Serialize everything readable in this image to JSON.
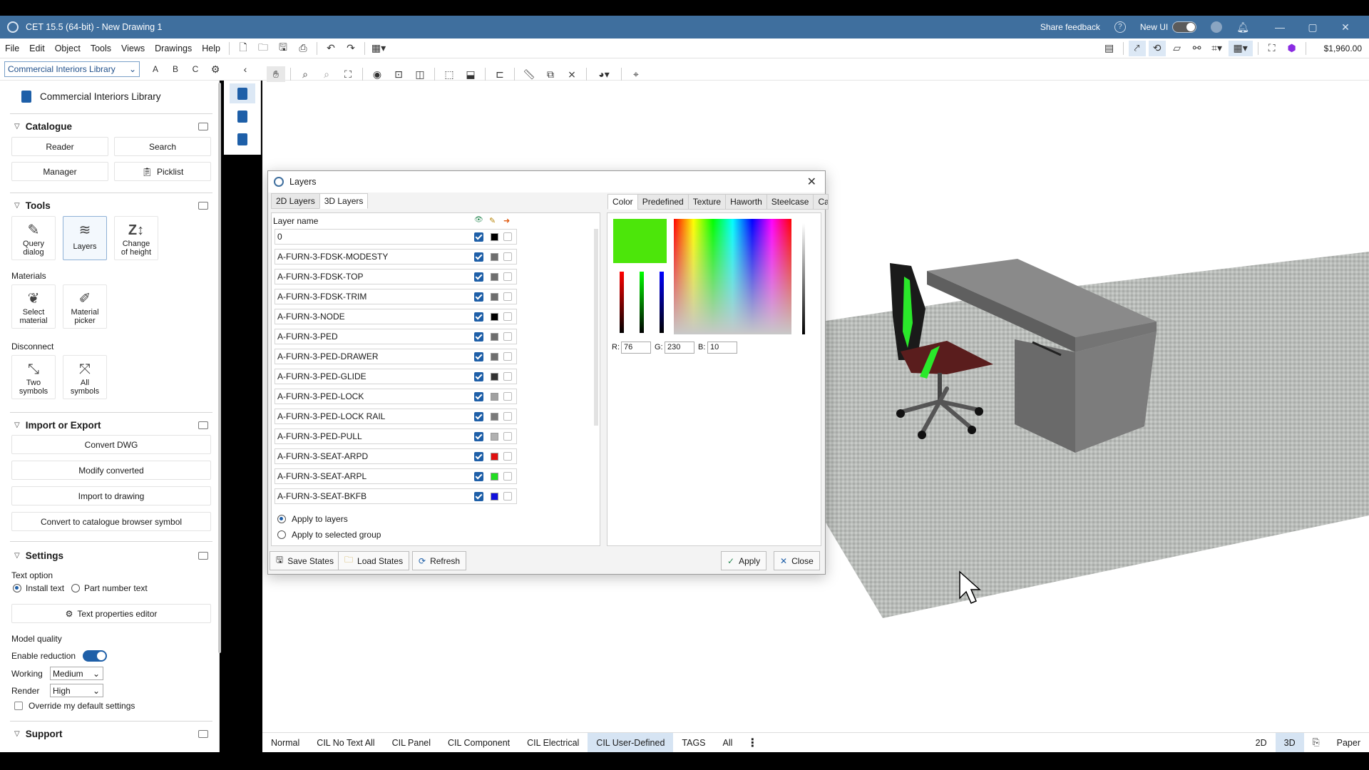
{
  "window": {
    "title": "CET 15.5 (64-bit) - New Drawing 1",
    "share_feedback": "Share feedback",
    "new_ui_label": "New UI",
    "minimize": "—",
    "maximize": "▢",
    "close": "✕"
  },
  "menu": {
    "items": [
      "File",
      "Edit",
      "Object",
      "Tools",
      "Views",
      "Drawings",
      "Help"
    ],
    "price": "$1,960.00"
  },
  "toolbar": {
    "library_select": "Commercial Interiors Library",
    "letters": [
      "A",
      "B",
      "C"
    ]
  },
  "left_panel": {
    "library_title": "Commercial Interiors Library",
    "catalogue": {
      "title": "Catalogue",
      "buttons": [
        "Reader",
        "Search",
        "Manager",
        "Picklist"
      ]
    },
    "tools": {
      "title": "Tools",
      "items": [
        {
          "line1": "Query",
          "line2": "dialog"
        },
        {
          "line1": "Layers",
          "line2": ""
        },
        {
          "line1": "Change",
          "line2": "of height"
        }
      ],
      "materials_label": "Materials",
      "materials": [
        {
          "line1": "Select",
          "line2": "material"
        },
        {
          "line1": "Material",
          "line2": "picker"
        }
      ],
      "disconnect_label": "Disconnect",
      "disconnect": [
        {
          "line1": "Two",
          "line2": "symbols"
        },
        {
          "line1": "All",
          "line2": "symbols"
        }
      ]
    },
    "import_export": {
      "title": "Import or Export",
      "buttons": [
        "Convert DWG",
        "Modify converted",
        "Import to drawing",
        "Convert to catalogue browser symbol"
      ]
    },
    "settings": {
      "title": "Settings",
      "text_option_label": "Text option",
      "install_text": "Install text",
      "part_number_text": "Part number text",
      "text_properties_editor": "Text properties editor",
      "model_quality_label": "Model quality",
      "enable_reduction": "Enable reduction",
      "working_label": "Working",
      "working_value": "Medium",
      "render_label": "Render",
      "render_value": "High",
      "override_defaults": "Override my default settings"
    },
    "support": {
      "title": "Support"
    }
  },
  "layers_dialog": {
    "title": "Layers",
    "tabs": [
      "2D Layers",
      "3D Layers"
    ],
    "active_tab": "3D Layers",
    "column_header": "Layer name",
    "rows": [
      {
        "name": "0",
        "color": "#000000"
      },
      {
        "name": "A-FURN-3-FDSK-MODESTY",
        "color": "#6e6e6e"
      },
      {
        "name": "A-FURN-3-FDSK-TOP",
        "color": "#6e6e6e"
      },
      {
        "name": "A-FURN-3-FDSK-TRIM",
        "color": "#6e6e6e"
      },
      {
        "name": "A-FURN-3-NODE",
        "color": "#000000"
      },
      {
        "name": "A-FURN-3-PED",
        "color": "#6e6e6e"
      },
      {
        "name": "A-FURN-3-PED-DRAWER",
        "color": "#6e6e6e"
      },
      {
        "name": "A-FURN-3-PED-GLIDE",
        "color": "#333333"
      },
      {
        "name": "A-FURN-3-PED-LOCK",
        "color": "#a0a0a0"
      },
      {
        "name": "A-FURN-3-PED-LOCK RAIL",
        "color": "#7a7a7a"
      },
      {
        "name": "A-FURN-3-PED-PULL",
        "color": "#b0b0b0"
      },
      {
        "name": "A-FURN-3-SEAT-ARPD",
        "color": "#e01010"
      },
      {
        "name": "A-FURN-3-SEAT-ARPL",
        "color": "#22dd22"
      },
      {
        "name": "A-FURN-3-SEAT-BKFB",
        "color": "#1010dd"
      }
    ],
    "apply_to_layers": "Apply to layers",
    "apply_to_group": "Apply to selected group",
    "color_tabs": [
      "Color",
      "Predefined",
      "Texture",
      "Haworth",
      "Steelcase",
      "Cate"
    ],
    "active_color_tab": "Color",
    "current_color": "#4ce60a",
    "r_label": "R:",
    "r_value": "76",
    "g_label": "G:",
    "g_value": "230",
    "b_label": "B:",
    "b_value": "10",
    "buttons": {
      "save_states": "Save States",
      "load_states": "Load States",
      "refresh": "Refresh",
      "apply": "Apply",
      "close": "Close"
    }
  },
  "bottom_tabs": [
    "Normal",
    "CIL No Text All",
    "CIL Panel",
    "CIL Component",
    "CIL Electrical",
    "CIL User-Defined",
    "TAGS",
    "All"
  ],
  "active_bottom_tab": "CIL User-Defined",
  "view_modes": [
    "2D",
    "3D",
    "Paper"
  ],
  "active_view_mode": "3D"
}
